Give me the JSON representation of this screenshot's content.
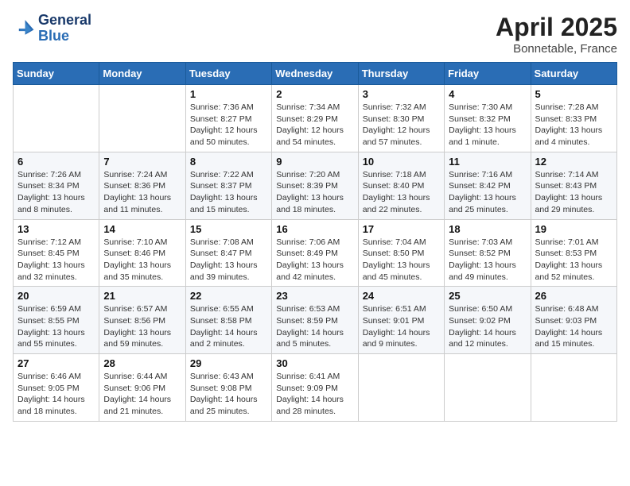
{
  "header": {
    "logo_line1": "General",
    "logo_line2": "Blue",
    "month": "April 2025",
    "location": "Bonnetable, France"
  },
  "weekdays": [
    "Sunday",
    "Monday",
    "Tuesday",
    "Wednesday",
    "Thursday",
    "Friday",
    "Saturday"
  ],
  "weeks": [
    [
      {
        "day": "",
        "info": ""
      },
      {
        "day": "",
        "info": ""
      },
      {
        "day": "1",
        "info": "Sunrise: 7:36 AM\nSunset: 8:27 PM\nDaylight: 12 hours and 50 minutes."
      },
      {
        "day": "2",
        "info": "Sunrise: 7:34 AM\nSunset: 8:29 PM\nDaylight: 12 hours and 54 minutes."
      },
      {
        "day": "3",
        "info": "Sunrise: 7:32 AM\nSunset: 8:30 PM\nDaylight: 12 hours and 57 minutes."
      },
      {
        "day": "4",
        "info": "Sunrise: 7:30 AM\nSunset: 8:32 PM\nDaylight: 13 hours and 1 minute."
      },
      {
        "day": "5",
        "info": "Sunrise: 7:28 AM\nSunset: 8:33 PM\nDaylight: 13 hours and 4 minutes."
      }
    ],
    [
      {
        "day": "6",
        "info": "Sunrise: 7:26 AM\nSunset: 8:34 PM\nDaylight: 13 hours and 8 minutes."
      },
      {
        "day": "7",
        "info": "Sunrise: 7:24 AM\nSunset: 8:36 PM\nDaylight: 13 hours and 11 minutes."
      },
      {
        "day": "8",
        "info": "Sunrise: 7:22 AM\nSunset: 8:37 PM\nDaylight: 13 hours and 15 minutes."
      },
      {
        "day": "9",
        "info": "Sunrise: 7:20 AM\nSunset: 8:39 PM\nDaylight: 13 hours and 18 minutes."
      },
      {
        "day": "10",
        "info": "Sunrise: 7:18 AM\nSunset: 8:40 PM\nDaylight: 13 hours and 22 minutes."
      },
      {
        "day": "11",
        "info": "Sunrise: 7:16 AM\nSunset: 8:42 PM\nDaylight: 13 hours and 25 minutes."
      },
      {
        "day": "12",
        "info": "Sunrise: 7:14 AM\nSunset: 8:43 PM\nDaylight: 13 hours and 29 minutes."
      }
    ],
    [
      {
        "day": "13",
        "info": "Sunrise: 7:12 AM\nSunset: 8:45 PM\nDaylight: 13 hours and 32 minutes."
      },
      {
        "day": "14",
        "info": "Sunrise: 7:10 AM\nSunset: 8:46 PM\nDaylight: 13 hours and 35 minutes."
      },
      {
        "day": "15",
        "info": "Sunrise: 7:08 AM\nSunset: 8:47 PM\nDaylight: 13 hours and 39 minutes."
      },
      {
        "day": "16",
        "info": "Sunrise: 7:06 AM\nSunset: 8:49 PM\nDaylight: 13 hours and 42 minutes."
      },
      {
        "day": "17",
        "info": "Sunrise: 7:04 AM\nSunset: 8:50 PM\nDaylight: 13 hours and 45 minutes."
      },
      {
        "day": "18",
        "info": "Sunrise: 7:03 AM\nSunset: 8:52 PM\nDaylight: 13 hours and 49 minutes."
      },
      {
        "day": "19",
        "info": "Sunrise: 7:01 AM\nSunset: 8:53 PM\nDaylight: 13 hours and 52 minutes."
      }
    ],
    [
      {
        "day": "20",
        "info": "Sunrise: 6:59 AM\nSunset: 8:55 PM\nDaylight: 13 hours and 55 minutes."
      },
      {
        "day": "21",
        "info": "Sunrise: 6:57 AM\nSunset: 8:56 PM\nDaylight: 13 hours and 59 minutes."
      },
      {
        "day": "22",
        "info": "Sunrise: 6:55 AM\nSunset: 8:58 PM\nDaylight: 14 hours and 2 minutes."
      },
      {
        "day": "23",
        "info": "Sunrise: 6:53 AM\nSunset: 8:59 PM\nDaylight: 14 hours and 5 minutes."
      },
      {
        "day": "24",
        "info": "Sunrise: 6:51 AM\nSunset: 9:01 PM\nDaylight: 14 hours and 9 minutes."
      },
      {
        "day": "25",
        "info": "Sunrise: 6:50 AM\nSunset: 9:02 PM\nDaylight: 14 hours and 12 minutes."
      },
      {
        "day": "26",
        "info": "Sunrise: 6:48 AM\nSunset: 9:03 PM\nDaylight: 14 hours and 15 minutes."
      }
    ],
    [
      {
        "day": "27",
        "info": "Sunrise: 6:46 AM\nSunset: 9:05 PM\nDaylight: 14 hours and 18 minutes."
      },
      {
        "day": "28",
        "info": "Sunrise: 6:44 AM\nSunset: 9:06 PM\nDaylight: 14 hours and 21 minutes."
      },
      {
        "day": "29",
        "info": "Sunrise: 6:43 AM\nSunset: 9:08 PM\nDaylight: 14 hours and 25 minutes."
      },
      {
        "day": "30",
        "info": "Sunrise: 6:41 AM\nSunset: 9:09 PM\nDaylight: 14 hours and 28 minutes."
      },
      {
        "day": "",
        "info": ""
      },
      {
        "day": "",
        "info": ""
      },
      {
        "day": "",
        "info": ""
      }
    ]
  ]
}
